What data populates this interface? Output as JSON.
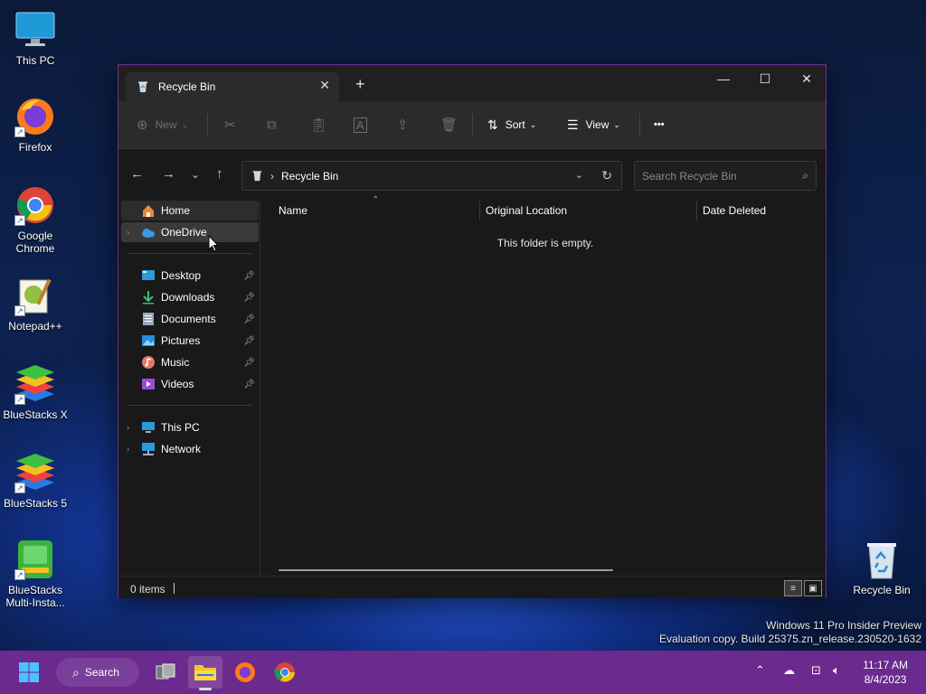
{
  "desktop": {
    "icons": [
      {
        "label": "This PC"
      },
      {
        "label": "Firefox"
      },
      {
        "label": "Google Chrome"
      },
      {
        "label": "Notepad++"
      },
      {
        "label": "BlueStacks X"
      },
      {
        "label": "BlueStacks 5"
      },
      {
        "label": "BlueStacks Multi-Insta..."
      },
      {
        "label": "Recycle Bin"
      }
    ],
    "watermark_line1": "Windows 11 Pro Insider Preview",
    "watermark_line2": "Evaluation copy. Build 25375.zn_release.230520-1632"
  },
  "window": {
    "tab_title": "Recycle Bin",
    "tab_close": "✕",
    "new_tab": "+",
    "controls": {
      "minimize": "—",
      "maximize": "☐",
      "close": "✕"
    },
    "commands": {
      "new_label": "New",
      "sort_label": "Sort",
      "view_label": "View",
      "more_label": "•••"
    },
    "address": {
      "path": "Recycle Bin",
      "separator": "›"
    },
    "search_placeholder": "Search Recycle Bin",
    "sidebar": {
      "items": [
        {
          "label": "Home"
        },
        {
          "label": "OneDrive"
        },
        {
          "label": "Desktop"
        },
        {
          "label": "Downloads"
        },
        {
          "label": "Documents"
        },
        {
          "label": "Pictures"
        },
        {
          "label": "Music"
        },
        {
          "label": "Videos"
        },
        {
          "label": "This PC"
        },
        {
          "label": "Network"
        }
      ]
    },
    "columns": {
      "name": "Name",
      "original_location": "Original Location",
      "date_deleted": "Date Deleted"
    },
    "empty_message": "This folder is empty.",
    "status": {
      "items": "0 items"
    }
  },
  "taskbar": {
    "search_label": "Search",
    "time": "11:17 AM",
    "date": "8/4/2023"
  },
  "colors": {
    "taskbar": "#6a2a8e",
    "window_border": "#6a2e8e",
    "window_bg": "#191919"
  }
}
